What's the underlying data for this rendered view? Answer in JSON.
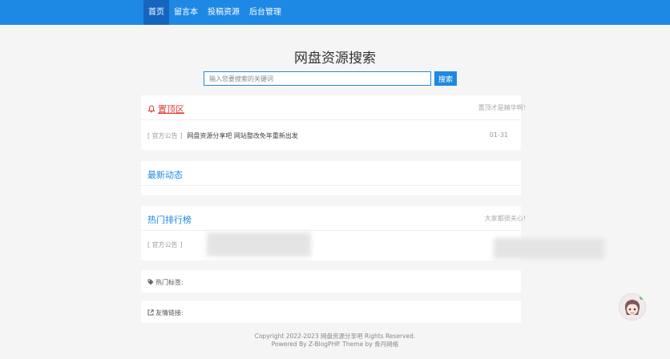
{
  "nav": {
    "items": [
      {
        "label": "首页",
        "active": true
      },
      {
        "label": "留言本"
      },
      {
        "label": "投稿资源"
      },
      {
        "label": "后台管理"
      }
    ]
  },
  "search": {
    "title": "网盘资源搜索",
    "placeholder": "输入您要搜索的关键词",
    "button": "搜索"
  },
  "pinned": {
    "title": "置顶区",
    "right": "置顶才是精华啊!",
    "items": [
      {
        "tag": "[ 官方公告 ]",
        "text": "网盘资源分享吧 网站整改免年重新出发",
        "date": "01-31"
      }
    ]
  },
  "latest": {
    "title": "最新动态"
  },
  "hot": {
    "title": "热门排行榜",
    "right": "大家都很关心!",
    "items": [
      {
        "tag": "[ 官方公告 ]"
      }
    ]
  },
  "tags": {
    "label": "热门标签:"
  },
  "links": {
    "label": "友情链接:"
  },
  "footer": {
    "line1": "Copyright 2022-2023 网盘资源分享吧 Rights Reserved.",
    "line2": "Powered By Z-BlogPHP. Theme by 青丹网络"
  },
  "colors": {
    "accent": "#1e88e5",
    "pinned_red": "#e53935"
  }
}
